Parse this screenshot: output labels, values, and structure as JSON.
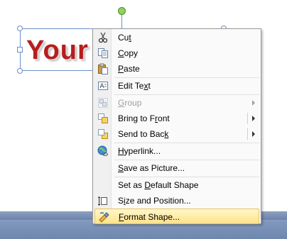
{
  "wordart": {
    "text": "Your"
  },
  "menu": {
    "items": [
      {
        "pre": "Cu",
        "key": "t",
        "post": "",
        "icon": "scissors-icon"
      },
      {
        "pre": "",
        "key": "C",
        "post": "opy",
        "icon": "copy-icon"
      },
      {
        "pre": "",
        "key": "P",
        "post": "aste",
        "icon": "paste-icon"
      },
      {
        "pre": "Edit Te",
        "key": "x",
        "post": "t",
        "icon": "edit-text-icon"
      },
      {
        "pre": "",
        "key": "G",
        "post": "roup",
        "icon": "group-icon",
        "disabled": true
      },
      {
        "pre": "Bring to F",
        "key": "r",
        "post": "ont",
        "icon": "bring-to-front-icon"
      },
      {
        "pre": "Send to Bac",
        "key": "k",
        "post": "",
        "icon": "send-to-back-icon"
      },
      {
        "pre": "",
        "key": "H",
        "post": "yperlink...",
        "icon": "hyperlink-icon"
      },
      {
        "pre": "",
        "key": "S",
        "post": "ave as Picture...",
        "icon": ""
      },
      {
        "pre": "Set as ",
        "key": "D",
        "post": "efault Shape",
        "icon": ""
      },
      {
        "pre": "S",
        "key": "i",
        "post": "ze and Position...",
        "icon": "size-position-icon"
      },
      {
        "pre": "",
        "key": "F",
        "post": "ormat Shape...",
        "icon": "format-shape-icon"
      }
    ]
  }
}
